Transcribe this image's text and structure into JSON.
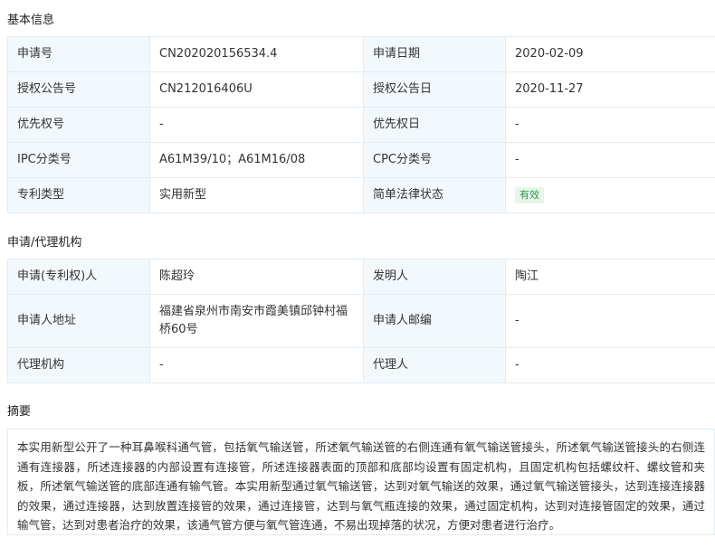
{
  "basic": {
    "title": "基本信息",
    "app_no_label": "申请号",
    "app_no": "CN202020156534.4",
    "app_date_label": "申请日期",
    "app_date": "2020-02-09",
    "pub_no_label": "授权公告号",
    "pub_no": "CN212016406U",
    "pub_date_label": "授权公告日",
    "pub_date": "2020-11-27",
    "priority_no_label": "优先权号",
    "priority_no": "-",
    "priority_date_label": "优先权日",
    "priority_date": "-",
    "ipc_label": "IPC分类号",
    "ipc": "A61M39/10；A61M16/08",
    "cpc_label": "CPC分类号",
    "cpc": "-",
    "type_label": "专利类型",
    "type": "实用新型",
    "status_label": "简单法律状态",
    "status": "有效"
  },
  "agency": {
    "title": "申请/代理机构",
    "applicant_label": "申请(专利权)人",
    "applicant": "陈超玲",
    "inventor_label": "发明人",
    "inventor": "陶江",
    "address_label": "申请人地址",
    "address": "福建省泉州市南安市霞美镇邱钟村福桥60号",
    "zip_label": "申请人邮编",
    "zip": "-",
    "agency_label": "代理机构",
    "agency": "-",
    "agent_label": "代理人",
    "agent": "-"
  },
  "abstract": {
    "title": "摘要",
    "text": "本实用新型公开了一种耳鼻喉科通气管，包括氧气输送管，所述氧气输送管的右侧连通有氧气输送管接头，所述氧气输送管接头的右侧连通有连接器，所述连接器的内部设置有连接管，所述连接器表面的顶部和底部均设置有固定机构，且固定机构包括螺纹杆、螺纹管和夹板，所述氧气输送管的底部连通有输气管。本实用新型通过氧气输送管，达到对氧气输送的效果，通过氧气输送管接头，达到连接连接器的效果，通过连接器，达到放置连接管的效果，通过连接管，达到与氧气瓶连接的效果，通过固定机构，达到对连接管固定的效果，通过输气管，达到对患者治疗的效果，该通气管方便与氧气管连通，不易出现掉落的状况，方便对患者进行治疗。"
  }
}
